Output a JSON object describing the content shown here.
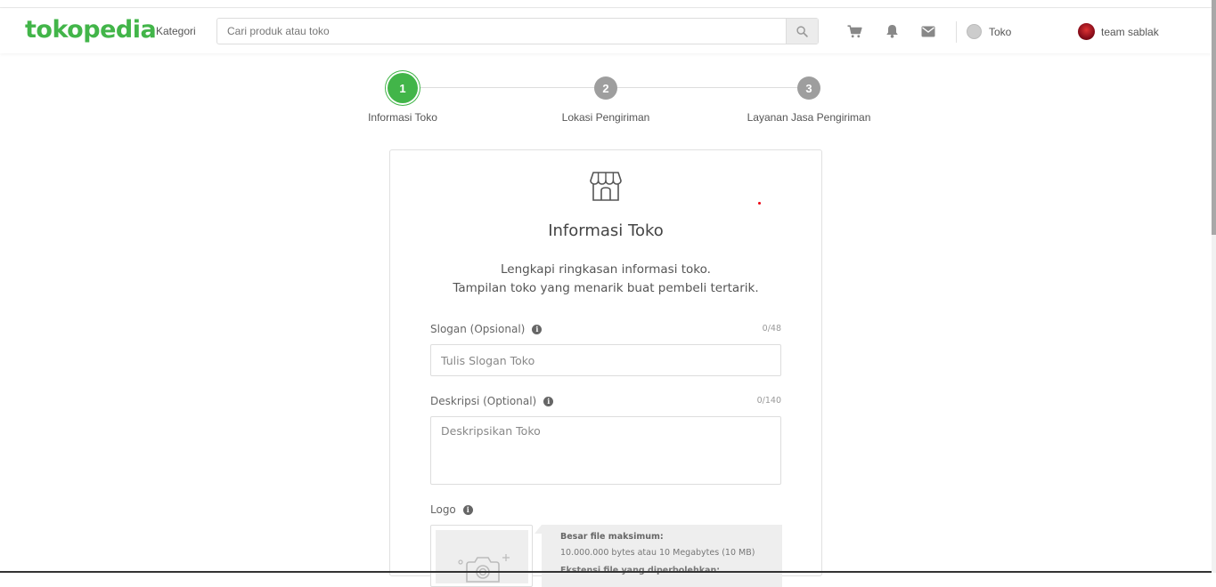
{
  "header": {
    "logo": "tokopedia",
    "kategori": "Kategori",
    "search_placeholder": "Cari produk atau toko",
    "toko_label": "Toko",
    "user_name": "team sablak"
  },
  "steps": [
    {
      "number": "1",
      "label": "Informasi Toko",
      "active": true
    },
    {
      "number": "2",
      "label": "Lokasi Pengiriman",
      "active": false
    },
    {
      "number": "3",
      "label": "Layanan Jasa Pengiriman",
      "active": false
    }
  ],
  "form": {
    "title": "Informasi Toko",
    "subtitle_line1": "Lengkapi ringkasan informasi toko.",
    "subtitle_line2": "Tampilan toko yang menarik buat pembeli tertarik.",
    "slogan": {
      "label": "Slogan (Opsional)",
      "counter": "0/48",
      "placeholder": "Tulis Slogan Toko",
      "value": ""
    },
    "deskripsi": {
      "label": "Deskripsi (Optional)",
      "counter": "0/140",
      "placeholder": "Deskripsikan Toko",
      "value": ""
    },
    "logo": {
      "label": "Logo",
      "info_title": "Besar file maksimum:",
      "info_size": "10.000.000 bytes atau 10 Megabytes (10 MB)",
      "info_more": "Ekstensi file yang diperbolehkan:"
    }
  },
  "colors": {
    "brand": "#42b549",
    "step_inactive": "#9e9e9e"
  },
  "icons": [
    "search-icon",
    "cart-icon",
    "bell-icon",
    "mail-icon",
    "store-icon",
    "info-icon",
    "camera-icon"
  ]
}
